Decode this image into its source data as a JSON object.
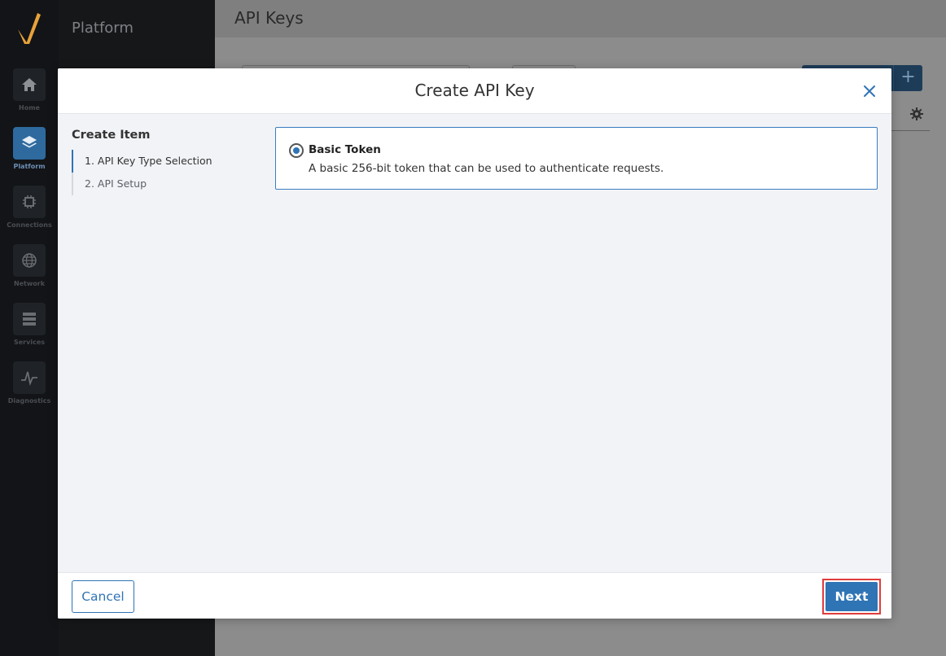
{
  "app": {
    "section_title": "Platform",
    "page_title": "API Keys"
  },
  "rail": {
    "items": [
      {
        "label": "Home",
        "icon": "home-icon"
      },
      {
        "label": "Platform",
        "icon": "layers-icon",
        "active": true
      },
      {
        "label": "Connections",
        "icon": "connections-icon"
      },
      {
        "label": "Network",
        "icon": "globe-icon"
      },
      {
        "label": "Services",
        "icon": "server-icon"
      },
      {
        "label": "Diagnostics",
        "icon": "pulse-icon"
      }
    ]
  },
  "modal": {
    "title": "Create API Key",
    "steps_title": "Create Item",
    "steps": [
      {
        "label": "1. API Key Type Selection",
        "active": true
      },
      {
        "label": "2. API Setup",
        "active": false
      }
    ],
    "option": {
      "title": "Basic Token",
      "description": "A basic 256-bit token that can be used to authenticate requests.",
      "selected": true
    },
    "cancel_label": "Cancel",
    "next_label": "Next"
  },
  "colors": {
    "accent": "#2f74b5",
    "rail_bg": "#121417",
    "highlight": "#e03c3c"
  }
}
